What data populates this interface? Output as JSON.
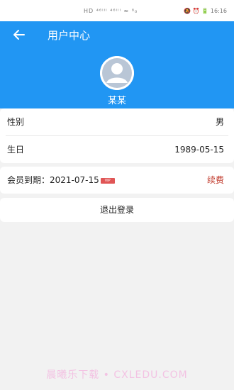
{
  "statusbar": {
    "left": "HD ⁴⁶ᴵᴵᴵ ⁴⁶ᴵᴵᴵ ≈ ⁸₀",
    "right": "🔕 ⏰ 🔋 16:16"
  },
  "header": {
    "title": "用户中心"
  },
  "profile": {
    "name": "某某"
  },
  "info": {
    "gender_label": "性别",
    "gender_value": "男",
    "birthday_label": "生日",
    "birthday_value": "1989-05-15"
  },
  "membership": {
    "label": "会员到期：",
    "expiry": "2021-07-15",
    "badge": "VIP",
    "renew_label": "续费"
  },
  "logout_label": "退出登录",
  "watermark": "晨曦乐下载 • CXLEDU.COM",
  "colors": {
    "primary": "#2196f3",
    "renew": "#c0392b",
    "badge": "#e05555",
    "background": "#f2f2f2"
  }
}
